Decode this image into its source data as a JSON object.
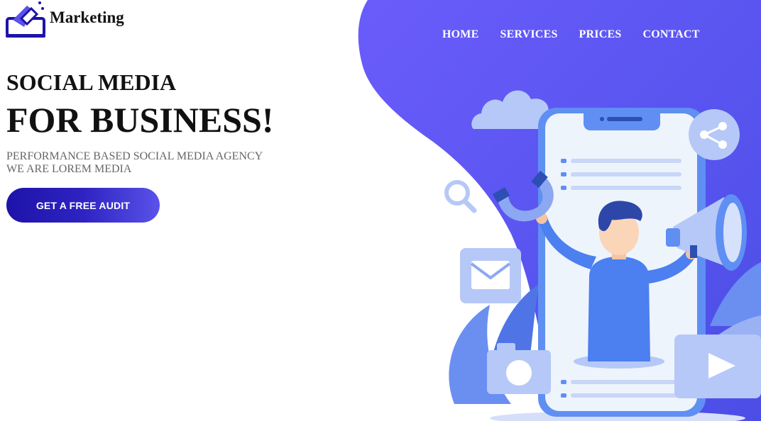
{
  "brand": {
    "name": "Marketing"
  },
  "nav": {
    "items": [
      "HOME",
      "SERVICES",
      "PRICES",
      "CONTACT"
    ]
  },
  "hero": {
    "line1": "SOCIAL MEDIA",
    "line2": "FOR BUSINESS!",
    "sub1": "PERFORMANCE BASED SOCIAL MEDIA AGENCY",
    "sub2": "WE ARE LOREM MEDIA",
    "cta": "GET A FREE AUDIT"
  },
  "colors": {
    "accent": "#6157f7",
    "accent_dark": "#1d13a8",
    "illus_light": "#b6c8f7",
    "illus_blue": "#5f8ff3"
  }
}
